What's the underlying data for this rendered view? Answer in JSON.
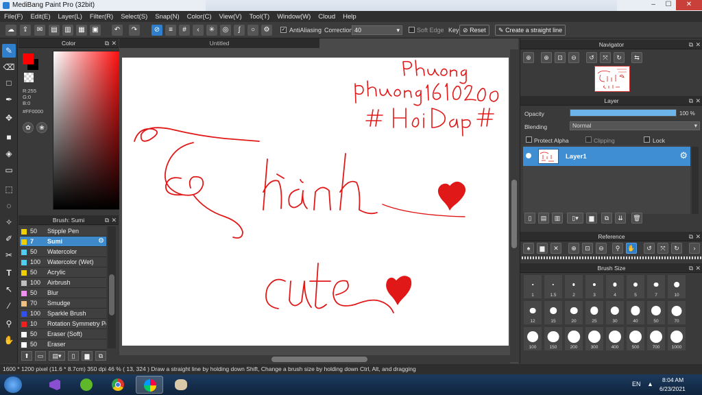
{
  "window": {
    "title": "MediBang Paint Pro (32bit)",
    "min": "–",
    "max": "☐",
    "close": "✕"
  },
  "menu": [
    "File(F)",
    "Edit(E)",
    "Layer(L)",
    "Filter(R)",
    "Select(S)",
    "Snap(N)",
    "Color(C)",
    "View(V)",
    "Tool(T)",
    "Window(W)",
    "Cloud",
    "Help"
  ],
  "toolbar": {
    "antialiasing": "AntiAliasing",
    "correction_label": "Correction",
    "correction_value": "40",
    "soft_edge": "Soft Edge",
    "key_label": "Key",
    "reset_label": "Reset",
    "straight_line": "Create a straight line"
  },
  "color_panel": {
    "title": "Color",
    "r": "R:255",
    "g": "G:0",
    "b": "B:0",
    "hex": "#FF0000",
    "fg_color": "#ff0000",
    "bg_color": "#000000"
  },
  "brush_panel": {
    "title": "Brush: Sumi",
    "items": [
      {
        "size": "50",
        "name": "Stipple Pen",
        "color": "#f0d000"
      },
      {
        "size": "7",
        "name": "Sumi",
        "color": "#f0d000"
      },
      {
        "size": "50",
        "name": "Watercolor",
        "color": "#4fd0f0"
      },
      {
        "size": "100",
        "name": "Watercolor (Wet)",
        "color": "#4fd0f0"
      },
      {
        "size": "50",
        "name": "Acrylic",
        "color": "#f0d000"
      },
      {
        "size": "100",
        "name": "Airbrush",
        "color": "#c0c0c0"
      },
      {
        "size": "50",
        "name": "Blur",
        "color": "#f090f0"
      },
      {
        "size": "70",
        "name": "Smudge",
        "color": "#f0c080"
      },
      {
        "size": "100",
        "name": "Sparkle Brush",
        "color": "#3050f0"
      },
      {
        "size": "10",
        "name": "Rotation Symmetry Pen",
        "color": "#f02020"
      },
      {
        "size": "50",
        "name": "Eraser (Soft)",
        "color": "#ffffff"
      },
      {
        "size": "50",
        "name": "Eraser",
        "color": "#ffffff"
      }
    ]
  },
  "canvas": {
    "tab_title": "Untitled",
    "stroke_color": "#e01818"
  },
  "navigator": {
    "title": "Navigator"
  },
  "layer_panel": {
    "title": "Layer",
    "opacity_label": "Opacity",
    "opacity_value": "100 %",
    "opacity_fraction": 1.0,
    "blending_label": "Blending",
    "blending_value": "Normal",
    "protect_alpha": "Protect Alpha",
    "clipping": "Clipping",
    "lock": "Lock",
    "layer_name": "Layer1"
  },
  "reference_panel": {
    "title": "Reference"
  },
  "brush_size_panel": {
    "title": "Brush Size",
    "sizes": [
      "1",
      "1.5",
      "2",
      "3",
      "4",
      "5",
      "7",
      "10",
      "12",
      "15",
      "20",
      "25",
      "30",
      "40",
      "50",
      "70",
      "100",
      "150",
      "200",
      "300",
      "400",
      "500",
      "700",
      "1000"
    ]
  },
  "status": {
    "text": "1600 * 1200 pixel   (11.6 * 8.7cm)   350 dpi   46 %   ( 13, 324 )   Draw a straight line by holding down Shift, Change a brush size by holding down Ctrl, Alt, and dragging"
  },
  "taskbar": {
    "lang": "EN",
    "time": "8:04 AM",
    "date": "6/23/2021"
  }
}
